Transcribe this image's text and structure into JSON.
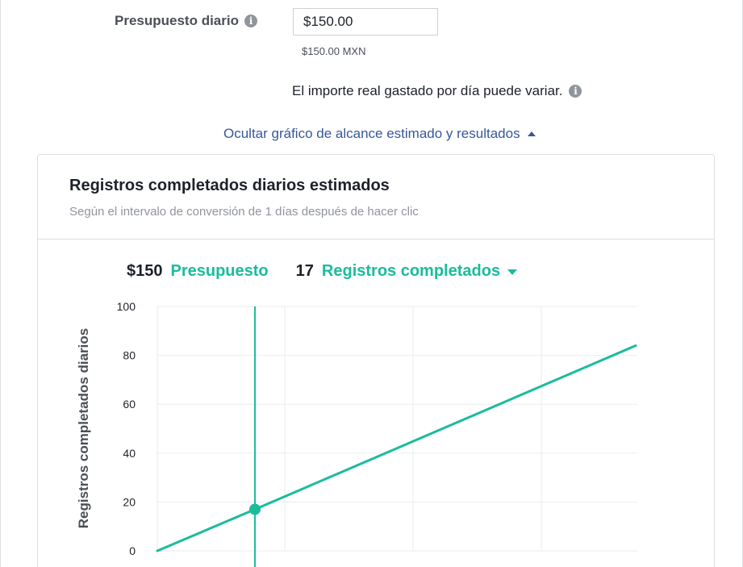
{
  "budget": {
    "label": "Presupuesto diario",
    "info_icon": "info-circle-icon",
    "input_value": "$150.00",
    "currency_note": "$150.00 MXN"
  },
  "note": {
    "text": "El importe real gastado por día puede variar.",
    "info_icon": "info-circle-icon"
  },
  "toggle": {
    "label": "Ocultar gráfico de alcance estimado y resultados",
    "icon": "caret-up-icon"
  },
  "card": {
    "title": "Registros completados diarios estimados",
    "subtitle": "Según el intervalo de conversión de 1 días después de hacer clic"
  },
  "summary": {
    "budget_value": "$150",
    "budget_label": "Presupuesto",
    "result_value": "17",
    "result_label": "Registros completados",
    "dropdown_icon": "caret-down-icon"
  },
  "colors": {
    "accent": "#1abc9c",
    "link": "#365899",
    "text": "#1d2129",
    "muted": "#90949c",
    "border": "#dddfe2"
  },
  "chart_data": {
    "type": "line",
    "title": "",
    "xlabel": "",
    "ylabel": "Registros completados diarios",
    "ylim": [
      0,
      100
    ],
    "yticks": [
      "0",
      "20",
      "40",
      "60",
      "80",
      "100"
    ],
    "grid": true,
    "series": [
      {
        "x": [
          0,
          150,
          735
        ],
        "y": [
          0,
          17,
          84
        ]
      }
    ],
    "marker": {
      "x": 150,
      "y": 17
    }
  }
}
